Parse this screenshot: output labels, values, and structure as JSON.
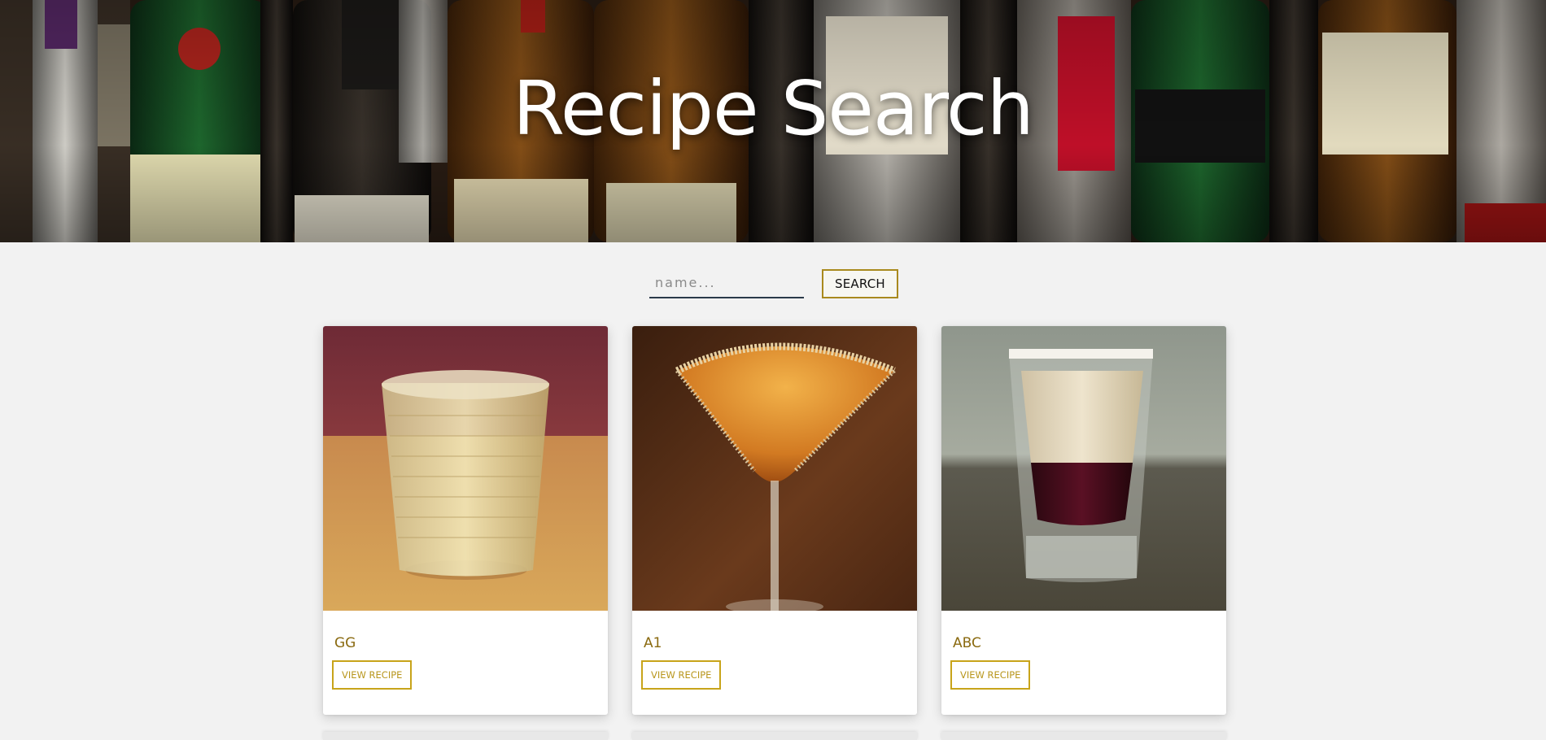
{
  "hero": {
    "title": "Recipe Search"
  },
  "search": {
    "placeholder": "name...",
    "value": "",
    "button_label": "SEARCH"
  },
  "recipes": [
    {
      "name": "GG",
      "button_label": "VIEW RECIPE"
    },
    {
      "name": "A1",
      "button_label": "VIEW RECIPE"
    },
    {
      "name": "ABC",
      "button_label": "VIEW RECIPE"
    }
  ],
  "colors": {
    "accent_gold": "#c8a41a",
    "title_gold": "#8a6a10",
    "page_bg": "#f2f2f2",
    "input_underline": "#2b3a4a"
  }
}
